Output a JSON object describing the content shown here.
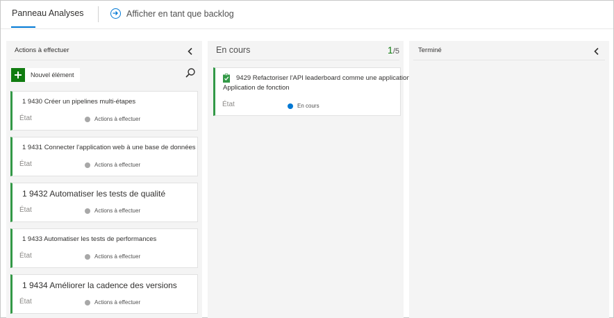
{
  "header": {
    "active_tab": "Panneau Analyses",
    "backlog_link": "Afficher en tant que backlog"
  },
  "columns": {
    "todo": {
      "title": "Actions à effectuer",
      "new_item_label": "Nouvel élément",
      "cards": [
        {
          "title": "1 9430 Créer un pipelines multi-étapes",
          "field": "État",
          "state": "Actions à effectuer"
        },
        {
          "title": "1 9431 Connecter l'application web à une base de données",
          "field": "État",
          "state": "Actions à effectuer"
        },
        {
          "title": "1 9432 Automatiser les tests de qualité",
          "field": "État",
          "state": "Actions à effectuer"
        },
        {
          "title": "1 9433 Automatiser les tests de performances",
          "field": "État",
          "state": "Actions à effectuer"
        },
        {
          "title": "1 9434 Améliorer la cadence des versions",
          "field": "État",
          "state": "Actions à effectuer"
        }
      ]
    },
    "inprogress": {
      "title": "En cours",
      "count": "1",
      "limit": "/5",
      "cards": [
        {
          "line1": "9429 Refactoriser l'API leaderboard comme une application",
          "line2": "Application de fonction",
          "field": "État",
          "state": "En cours"
        }
      ]
    },
    "done": {
      "title": "Terminé"
    }
  },
  "colors": {
    "accent": "#0078d4",
    "card_bar": "#339947",
    "add_button": "#107c10",
    "state_todo": "#a8a8a8",
    "state_inprogress": "#0078d4"
  }
}
